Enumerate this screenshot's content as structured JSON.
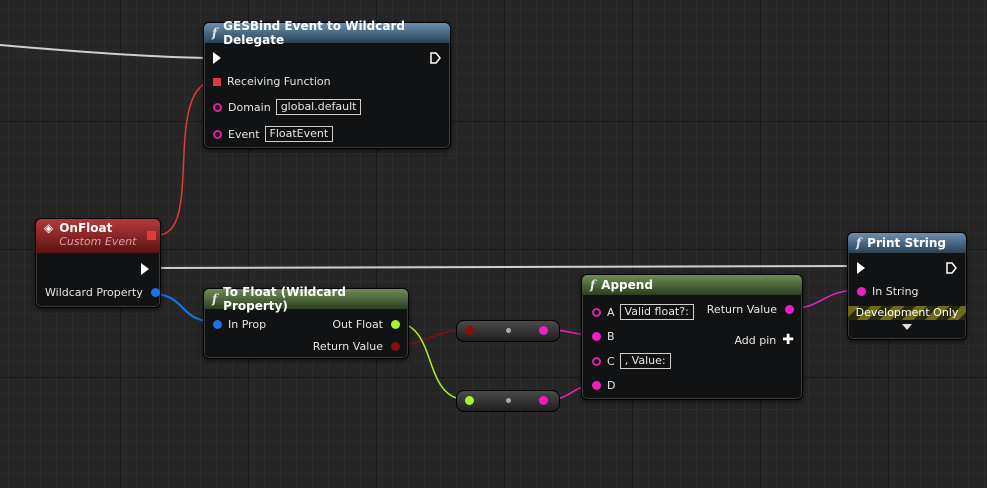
{
  "colors": {
    "exec": "#ffffff",
    "string": "#f020c0",
    "float": "#a8f030",
    "wildcard": "#1a73e8",
    "delegate": "#e03a3a",
    "byte": "#8a0e0e"
  },
  "nodes": {
    "ges_bind": {
      "title": "GESBind Event to Wildcard Delegate",
      "pins": {
        "receiving_function": "Receiving Function",
        "domain_label": "Domain",
        "domain_value": "global.default",
        "event_label": "Event",
        "event_value": "FloatEvent"
      }
    },
    "on_float": {
      "title": "OnFloat",
      "subtitle": "Custom Event",
      "pins": {
        "wildcard_property": "Wildcard Property"
      }
    },
    "to_float": {
      "title": "To Float (Wildcard Property)",
      "pins": {
        "in_prop": "In Prop",
        "out_float": "Out Float",
        "return_value": "Return Value"
      }
    },
    "append": {
      "title": "Append",
      "pins": {
        "a_label": "A",
        "a_value": "Valid float?:",
        "b_label": "B",
        "c_label": "C",
        "c_value": ", Value:",
        "d_label": "D",
        "return_value": "Return Value",
        "add_pin": "Add pin"
      }
    },
    "print_string": {
      "title": "Print String",
      "pins": {
        "in_string": "In String"
      },
      "dev_only": "Development Only"
    }
  },
  "icons": {
    "function": "function-icon",
    "event": "event-diamond-icon",
    "exec": "exec-arrow-icon",
    "add": "plus-icon",
    "expand": "chevron-down-icon"
  }
}
